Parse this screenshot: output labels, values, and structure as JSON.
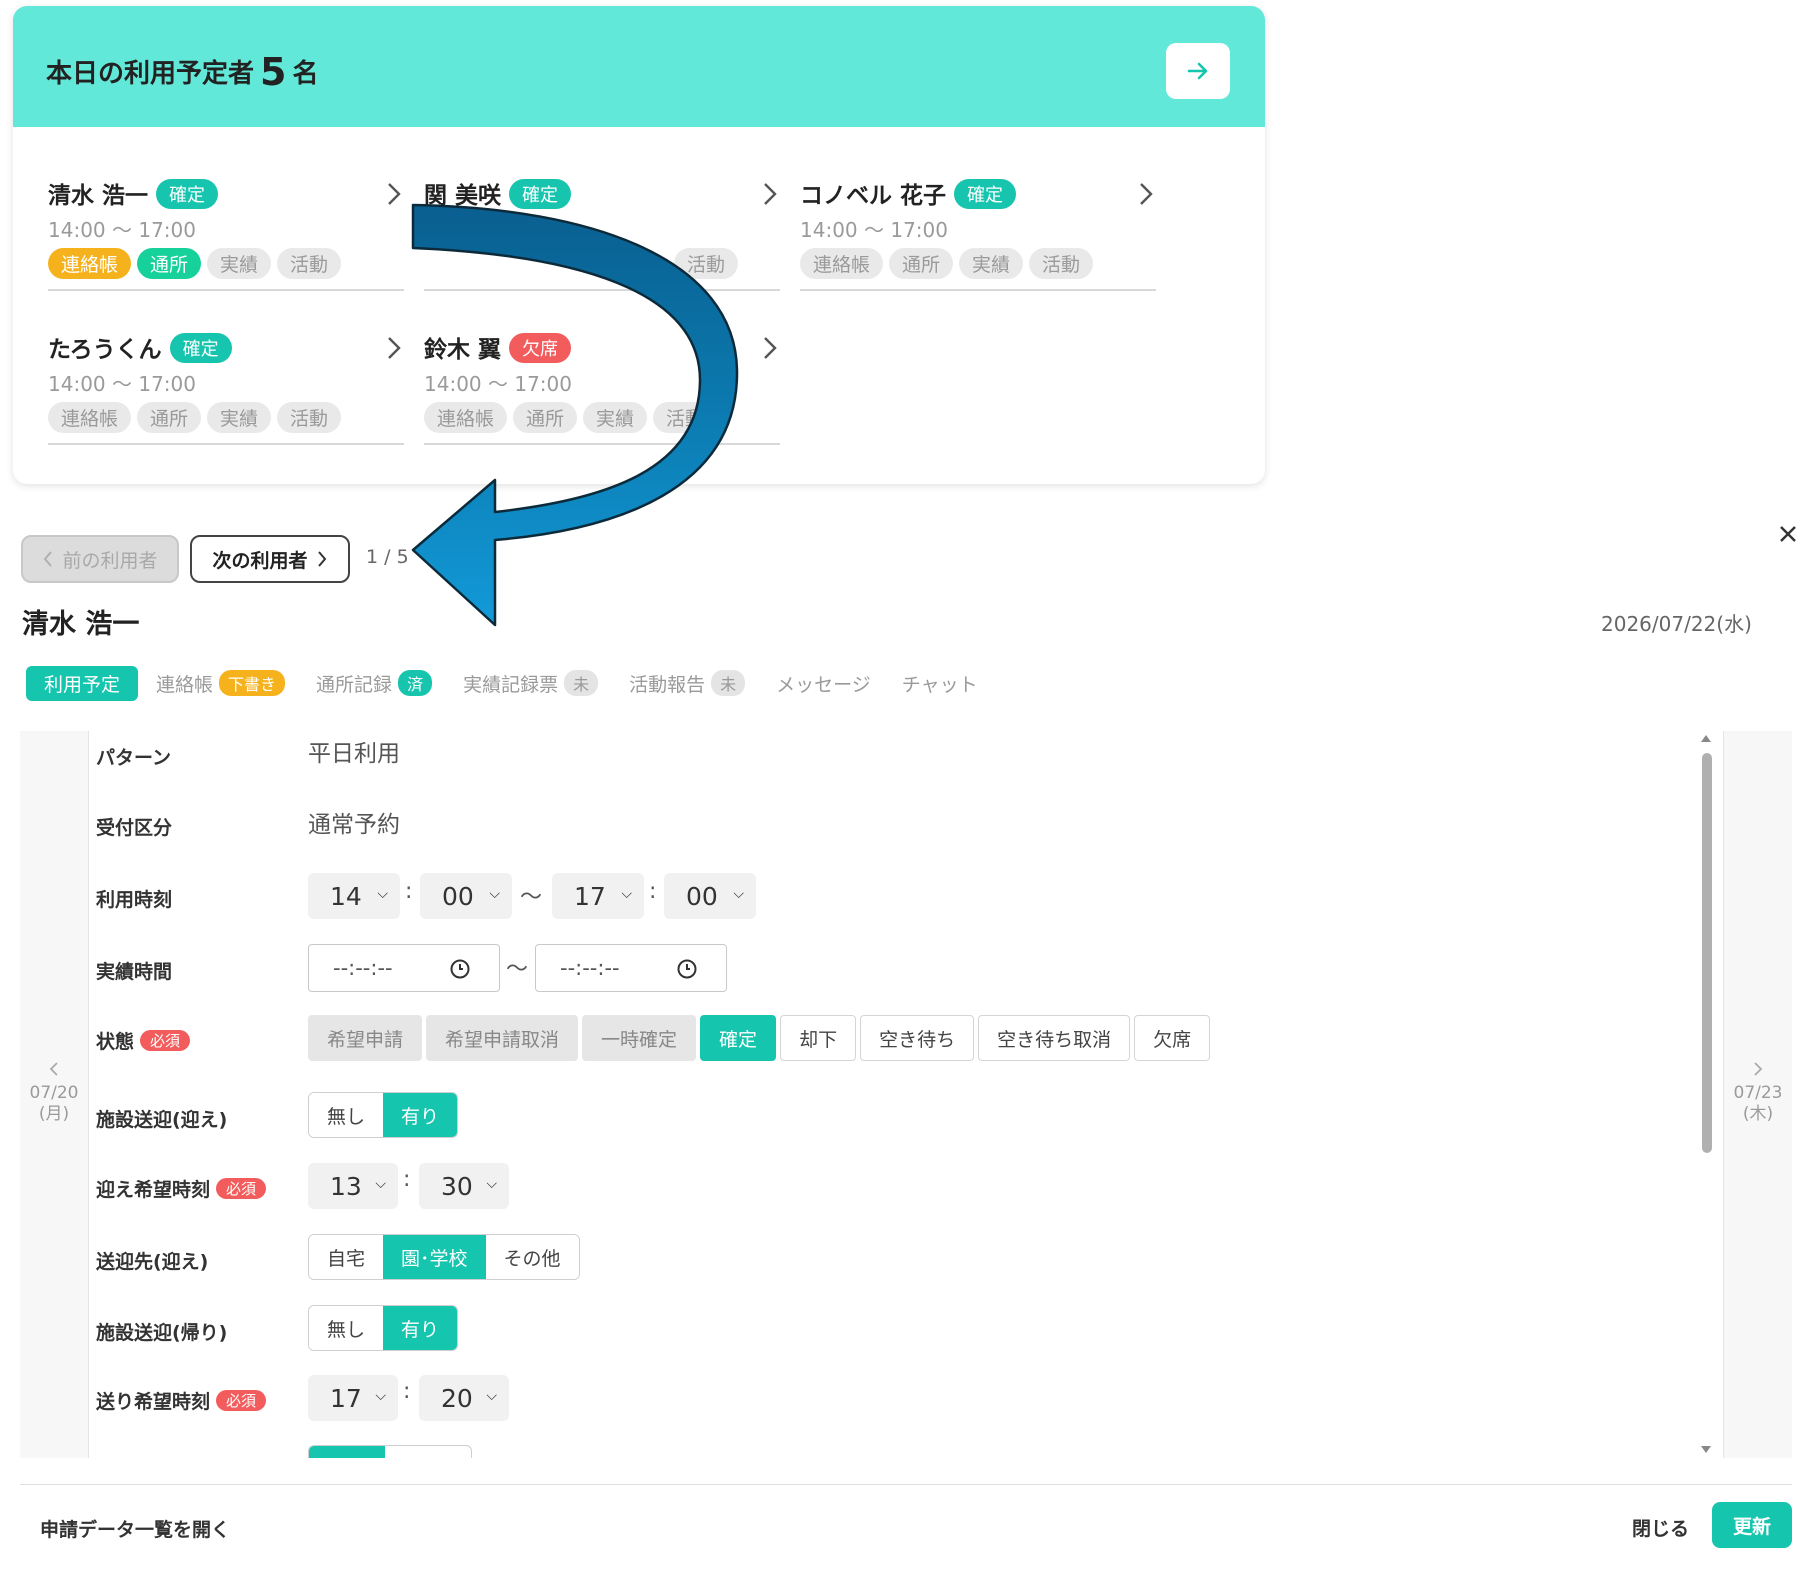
{
  "summary": {
    "title_prefix": "本日の利用予定者",
    "count": "5",
    "title_suffix": "名",
    "users": [
      {
        "name": "清水 浩一",
        "status": "確定",
        "status_color": "#17c5ae",
        "time": "14:00 ～ 17:00",
        "tags": [
          "連絡帳",
          "通所",
          "実績",
          "活動"
        ],
        "tag_states": [
          "yellow",
          "green",
          "grey",
          "grey"
        ]
      },
      {
        "name": "関 美咲",
        "status": "確定",
        "status_color": "#17c5ae",
        "time": "",
        "tags": [
          "",
          "",
          "",
          "活動"
        ],
        "tag_states": [
          "grey",
          "grey",
          "grey",
          "grey"
        ]
      },
      {
        "name": "コノベル 花子",
        "status": "確定",
        "status_color": "#17c5ae",
        "time": "14:00 ～ 17:00",
        "tags": [
          "連絡帳",
          "通所",
          "実績",
          "活動"
        ],
        "tag_states": [
          "grey",
          "grey",
          "grey",
          "grey"
        ]
      },
      {
        "name": "たろうくん",
        "status": "確定",
        "status_color": "#17c5ae",
        "time": "14:00 ～ 17:00",
        "tags": [
          "連絡帳",
          "通所",
          "実績",
          "活動"
        ],
        "tag_states": [
          "grey",
          "grey",
          "grey",
          "grey"
        ]
      },
      {
        "name": "鈴木 翼",
        "status": "欠席",
        "status_color": "#f25c5c",
        "time": "14:00 ～ 17:00",
        "tags": [
          "連絡帳",
          "通所",
          "実績",
          "活動"
        ],
        "tag_states": [
          "grey",
          "grey",
          "grey",
          "grey"
        ]
      }
    ]
  },
  "nav": {
    "prev_label": "前の利用者",
    "next_label": "次の利用者",
    "page": "1 / 5"
  },
  "detail": {
    "name": "清水 浩一",
    "date": "2026/07/22(水)",
    "tabs": [
      {
        "label": "利用予定",
        "badge": ""
      },
      {
        "label": "連絡帳",
        "badge": "下書き",
        "badge_color": "#f6b21c"
      },
      {
        "label": "通所記録",
        "badge": "済",
        "badge_color": "#17c5ae"
      },
      {
        "label": "実績記録票",
        "badge": "未",
        "badge_color": "#dedede"
      },
      {
        "label": "活動報告",
        "badge": "未",
        "badge_color": "#dedede"
      },
      {
        "label": "メッセージ",
        "badge": ""
      },
      {
        "label": "チャット",
        "badge": ""
      }
    ],
    "prev_day": {
      "date": "07/20",
      "weekday": "(月)"
    },
    "next_day": {
      "date": "07/23",
      "weekday": "(木)"
    },
    "required_label": "必須",
    "fields": {
      "pattern": {
        "label": "パターン",
        "value": "平日利用"
      },
      "reception": {
        "label": "受付区分",
        "value": "通常予約"
      },
      "usage_time": {
        "label": "利用時刻",
        "start_h": "14",
        "start_m": "00",
        "end_h": "17",
        "end_m": "00"
      },
      "actual_time": {
        "label": "実績時間",
        "start": "--:--:--",
        "end": "--:--:--"
      },
      "status": {
        "label": "状態",
        "options": [
          "希望申請",
          "希望申請取消",
          "一時確定",
          "確定",
          "却下",
          "空き待ち",
          "空き待ち取消",
          "欠席"
        ],
        "selected": "確定"
      },
      "pickup": {
        "label": "施設送迎(迎え)",
        "options": [
          "無し",
          "有り"
        ],
        "selected": "有り"
      },
      "pickup_time": {
        "label": "迎え希望時刻",
        "h": "13",
        "m": "30"
      },
      "pickup_dest": {
        "label": "送迎先(迎え)",
        "options": [
          "自宅",
          "園･学校",
          "その他"
        ],
        "selected": "園･学校"
      },
      "dropoff": {
        "label": "施設送迎(帰り)",
        "options": [
          "無し",
          "有り"
        ],
        "selected": "有り"
      },
      "dropoff_time": {
        "label": "送り希望時刻",
        "h": "17",
        "m": "20"
      }
    }
  },
  "footer": {
    "open_list": "申請データ一覧を開く",
    "close": "閉じる",
    "update": "更新"
  },
  "colors": {
    "accent": "#16c5ae",
    "header": "#62e8d8",
    "arrow": "#0f88c4",
    "required": "#f25c5c"
  }
}
